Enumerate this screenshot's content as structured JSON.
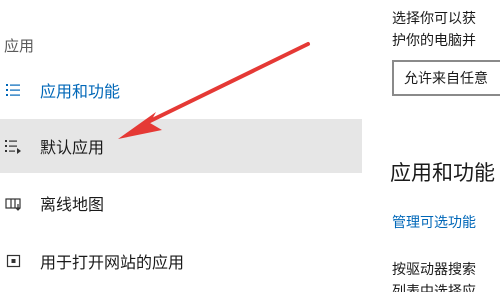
{
  "nav": {
    "section_title": "应用",
    "items": [
      {
        "label": "应用和功能",
        "icon": "list-icon"
      },
      {
        "label": "默认应用",
        "icon": "default-apps-icon"
      },
      {
        "label": "离线地图",
        "icon": "offline-maps-icon"
      },
      {
        "label": "用于打开网站的应用",
        "icon": "web-apps-icon"
      }
    ]
  },
  "content": {
    "install_desc_line1": "选择你可以获",
    "install_desc_line2": "护你的电脑并",
    "install_dropdown_value": "允许来自任意",
    "section_heading": "应用和功能",
    "manage_optional_link": "管理可选功能",
    "body_line1": "按驱动器搜索",
    "body_line2": "列表中选择应"
  },
  "colors": {
    "accent": "#0067b8",
    "selected_bg": "#e6e6e6",
    "annotation_arrow": "#e53935"
  }
}
